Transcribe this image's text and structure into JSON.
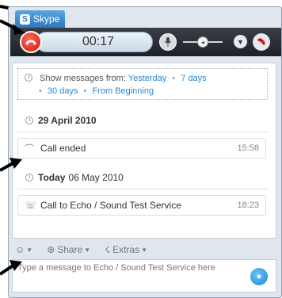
{
  "tab": {
    "label": "Skype",
    "logo": "S"
  },
  "call": {
    "timer": "00:17"
  },
  "history": {
    "show_from_label": "Show messages from:",
    "filters": [
      "Yesterday",
      "7 days",
      "30 days",
      "From Beginning"
    ],
    "day1": {
      "date_bold": "29 April 2010",
      "date_rest": ""
    },
    "event1": {
      "text": "Call ended",
      "time": "15:58"
    },
    "day2": {
      "date_bold": "Today",
      "date_rest": "06 May 2010"
    },
    "event2": {
      "text": "Call to Echo / Sound Test Service",
      "time": "18:23"
    }
  },
  "toolbar": {
    "share_label": "Share",
    "extras_label": "Extras"
  },
  "compose": {
    "placeholder": "Type a message to Echo / Sound Test Service here"
  },
  "colors": {
    "accent": "#2e86d1",
    "hangup": "#d0180c",
    "callbar": "#1d2126"
  }
}
